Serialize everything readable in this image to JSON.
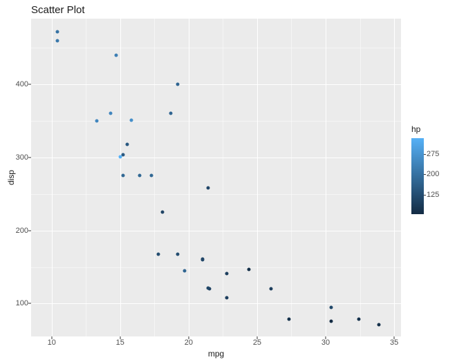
{
  "chart_data": {
    "type": "scatter",
    "title": "Scatter Plot",
    "xlabel": "mpg",
    "ylabel": "disp",
    "color_label": "hp",
    "xlim": [
      8.5,
      35.5
    ],
    "ylim": [
      55,
      490
    ],
    "x_ticks": [
      10,
      15,
      20,
      25,
      30,
      35
    ],
    "y_ticks": [
      100,
      200,
      300,
      400
    ],
    "color_range": [
      52,
      335
    ],
    "color_ticks": [
      125,
      200,
      275
    ],
    "color_stops": [
      {
        "v": 52,
        "c": "#132B43"
      },
      {
        "v": 335,
        "c": "#56B1F7"
      }
    ],
    "points": [
      {
        "mpg": 21.0,
        "disp": 160.0,
        "hp": 110
      },
      {
        "mpg": 22.8,
        "disp": 108.0,
        "hp": 93
      },
      {
        "mpg": 21.4,
        "disp": 258.0,
        "hp": 110
      },
      {
        "mpg": 18.7,
        "disp": 360.0,
        "hp": 175
      },
      {
        "mpg": 18.1,
        "disp": 225.0,
        "hp": 105
      },
      {
        "mpg": 14.3,
        "disp": 360.0,
        "hp": 245
      },
      {
        "mpg": 24.4,
        "disp": 146.7,
        "hp": 62
      },
      {
        "mpg": 22.8,
        "disp": 140.8,
        "hp": 95
      },
      {
        "mpg": 19.2,
        "disp": 167.6,
        "hp": 123
      },
      {
        "mpg": 17.8,
        "disp": 167.6,
        "hp": 123
      },
      {
        "mpg": 16.4,
        "disp": 275.8,
        "hp": 180
      },
      {
        "mpg": 17.3,
        "disp": 275.8,
        "hp": 180
      },
      {
        "mpg": 15.2,
        "disp": 275.8,
        "hp": 180
      },
      {
        "mpg": 10.4,
        "disp": 472.0,
        "hp": 205
      },
      {
        "mpg": 10.4,
        "disp": 460.0,
        "hp": 215
      },
      {
        "mpg": 14.7,
        "disp": 440.0,
        "hp": 230
      },
      {
        "mpg": 32.4,
        "disp": 78.7,
        "hp": 66
      },
      {
        "mpg": 30.4,
        "disp": 75.7,
        "hp": 52
      },
      {
        "mpg": 33.9,
        "disp": 71.1,
        "hp": 65
      },
      {
        "mpg": 21.5,
        "disp": 120.1,
        "hp": 97
      },
      {
        "mpg": 15.5,
        "disp": 318.0,
        "hp": 150
      },
      {
        "mpg": 15.2,
        "disp": 304.0,
        "hp": 150
      },
      {
        "mpg": 13.3,
        "disp": 350.0,
        "hp": 245
      },
      {
        "mpg": 19.2,
        "disp": 400.0,
        "hp": 175
      },
      {
        "mpg": 27.3,
        "disp": 79.0,
        "hp": 66
      },
      {
        "mpg": 26.0,
        "disp": 120.3,
        "hp": 91
      },
      {
        "mpg": 30.4,
        "disp": 95.1,
        "hp": 113
      },
      {
        "mpg": 15.8,
        "disp": 351.0,
        "hp": 264
      },
      {
        "mpg": 15.0,
        "disp": 301.0,
        "hp": 335
      },
      {
        "mpg": 21.4,
        "disp": 121.0,
        "hp": 109
      },
      {
        "mpg": 19.7,
        "disp": 145.0,
        "hp": 175
      },
      {
        "mpg": 21.0,
        "disp": 160.5,
        "hp": 110
      }
    ]
  }
}
